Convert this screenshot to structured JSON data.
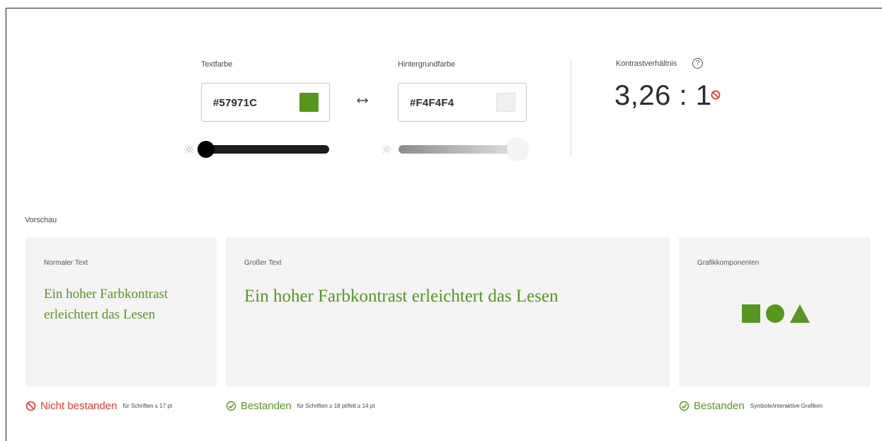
{
  "colors": {
    "text_color": "#57971C",
    "background_color": "#F4F4F4",
    "fail": "#e03b2a",
    "pass": "#57971c"
  },
  "text_color_picker": {
    "label": "Textfarbe",
    "hex_value": "#57971C"
  },
  "background_color_picker": {
    "label": "Hintergrundfarbe",
    "hex_value": "#F4F4F4"
  },
  "swap_icon": "swap-arrows-icon",
  "contrast": {
    "label": "Kontrastverhältnis",
    "help_icon_glyph": "?",
    "ratio": "3,26 : 1",
    "status_icon": "fail-icon"
  },
  "preview": {
    "label": "Vorschau",
    "panels": [
      {
        "title": "Normaler Text",
        "sample_line1": "Ein hoher Farbkontrast",
        "sample_line2": "erleichtert das Lesen",
        "result": "Nicht bestanden",
        "note": "für Schriften ≤ 17 pt"
      },
      {
        "title": "Großer Text",
        "sample": "Ein hoher Farbkontrast erleichtert das Lesen",
        "result": "Bestanden",
        "note": "für Schriften ≥ 18 pt/fett ≥ 14 pt"
      },
      {
        "title": "Grafikkomponenten",
        "shapes": [
          "square-shape",
          "circle-shape",
          "triangle-shape"
        ],
        "result": "Bestanden",
        "note": "Symbole/interaktive Grafiken"
      }
    ]
  }
}
